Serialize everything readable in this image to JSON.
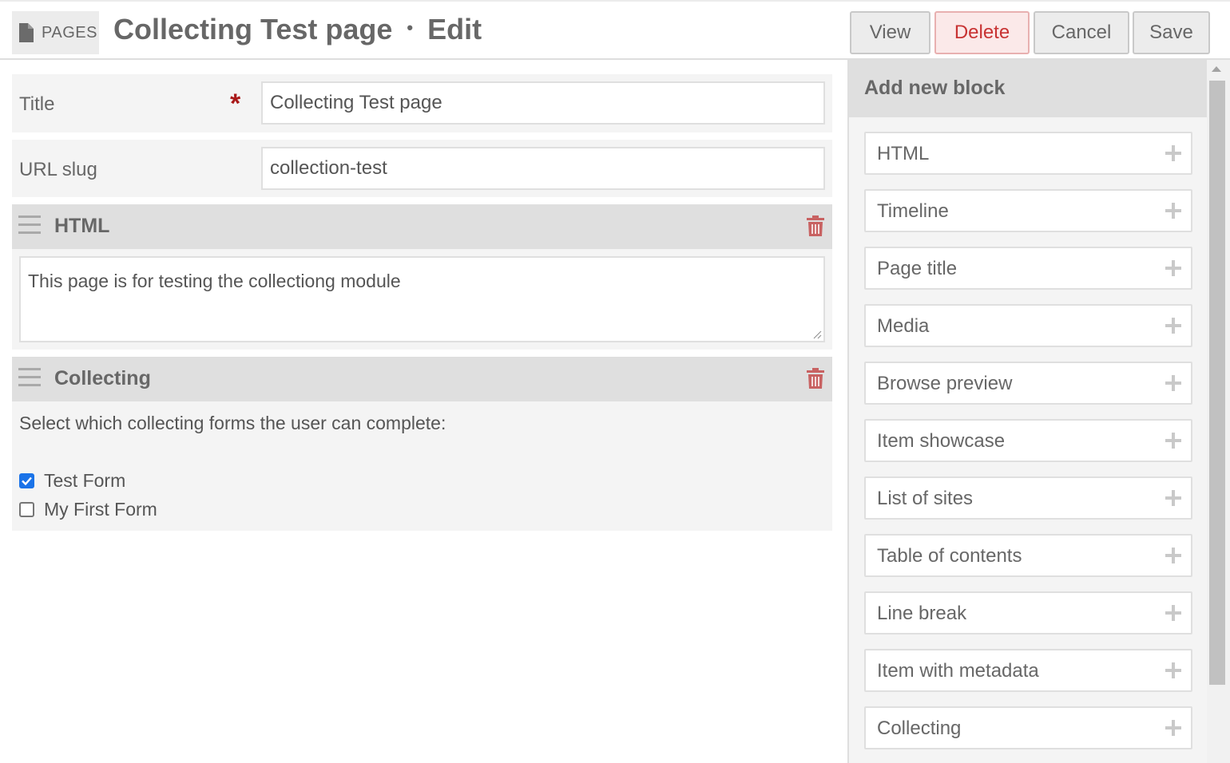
{
  "header": {
    "section_label": "PAGES",
    "page_name": "Collecting Test page",
    "separator": "•",
    "mode": "Edit",
    "buttons": {
      "view": "View",
      "delete": "Delete",
      "cancel": "Cancel",
      "save": "Save"
    }
  },
  "form": {
    "title_label": "Title",
    "title_required_mark": "*",
    "title_value": "Collecting Test page",
    "slug_label": "URL slug",
    "slug_value": "collection-test"
  },
  "blocks": [
    {
      "title": "HTML",
      "content": "This page is for testing the collectiong module"
    },
    {
      "title": "Collecting",
      "description": "Select which collecting forms the user can complete:",
      "options": [
        {
          "label": "Test Form",
          "checked": true
        },
        {
          "label": "My First Form",
          "checked": false
        }
      ]
    }
  ],
  "sidebar": {
    "title": "Add new block",
    "items": [
      "HTML",
      "Timeline",
      "Page title",
      "Media",
      "Browse preview",
      "Item showcase",
      "List of sites",
      "Table of contents",
      "Line break",
      "Item with metadata",
      "Collecting"
    ]
  },
  "colors": {
    "danger": "#c83333",
    "required": "#a91919",
    "accent": "#1a73e8"
  }
}
